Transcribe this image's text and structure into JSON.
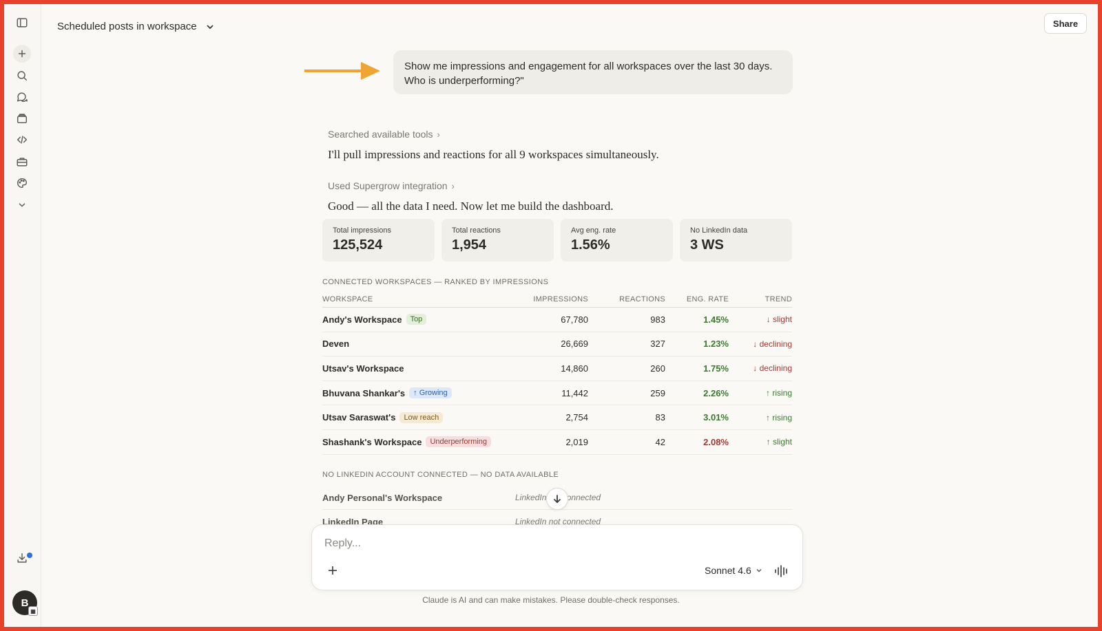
{
  "header": {
    "title": "Scheduled posts in workspace",
    "share_label": "Share"
  },
  "user_message": "Show me impressions and engagement for all workspaces over the last 30 days. Who is underperforming?\"",
  "tool_steps": [
    {
      "label": "Searched available tools",
      "chevron": "›"
    },
    {
      "label": "Used Supergrow integration",
      "chevron": "›"
    }
  ],
  "assistant_messages": [
    "I'll pull impressions and reactions for all 9 workspaces simultaneously.",
    "Good — all the data I need. Now let me build the dashboard."
  ],
  "stats": [
    {
      "label": "Total impressions",
      "value": "125,524"
    },
    {
      "label": "Total reactions",
      "value": "1,954"
    },
    {
      "label": "Avg eng. rate",
      "value": "1.56%"
    },
    {
      "label": "No LinkedIn data",
      "value": "3 WS"
    }
  ],
  "connected_section_title": "CONNECTED WORKSPACES — RANKED BY IMPRESSIONS",
  "table": {
    "headers": {
      "workspace": "WORKSPACE",
      "impressions": "IMPRESSIONS",
      "reactions": "REACTIONS",
      "eng_rate": "ENG. RATE",
      "trend": "TREND"
    },
    "rows": [
      {
        "workspace": "Andy's Workspace",
        "badge": "Top",
        "impressions": "67,780",
        "reactions": "983",
        "eng_rate": "1.45%",
        "trend": "↓ slight"
      },
      {
        "workspace": "Deven",
        "badge": "",
        "impressions": "26,669",
        "reactions": "327",
        "eng_rate": "1.23%",
        "trend": "↓ declining"
      },
      {
        "workspace": "Utsav's Workspace",
        "badge": "",
        "impressions": "14,860",
        "reactions": "260",
        "eng_rate": "1.75%",
        "trend": "↓ declining"
      },
      {
        "workspace": "Bhuvana Shankar's",
        "badge": "↑ Growing",
        "impressions": "11,442",
        "reactions": "259",
        "eng_rate": "2.26%",
        "trend": "↑ rising"
      },
      {
        "workspace": "Utsav Saraswat's",
        "badge": "Low reach",
        "impressions": "2,754",
        "reactions": "83",
        "eng_rate": "3.01%",
        "trend": "↑ rising"
      },
      {
        "workspace": "Shashank's Workspace",
        "badge": "Underperforming",
        "impressions": "2,019",
        "reactions": "42",
        "eng_rate": "2.08%",
        "trend": "↑ slight"
      }
    ]
  },
  "no_linkedin_section_title": "NO LINKEDIN ACCOUNT CONNECTED — NO DATA AVAILABLE",
  "no_linkedin_rows": [
    {
      "workspace": "Andy Personal's Workspace",
      "status": "LinkedIn not connected"
    },
    {
      "workspace": "LinkedIn Page",
      "status": "LinkedIn not connected"
    }
  ],
  "composer": {
    "placeholder": "Reply...",
    "model": "Sonnet 4.6"
  },
  "disclaimer": "Claude is AI and can make mistakes. Please double-check responses.",
  "avatar_initial": "B",
  "colors": {
    "accent_arrow": "#f0a431",
    "border_frame": "#e8412c",
    "positive": "#3a7a2e",
    "negative": "#a23a33"
  }
}
